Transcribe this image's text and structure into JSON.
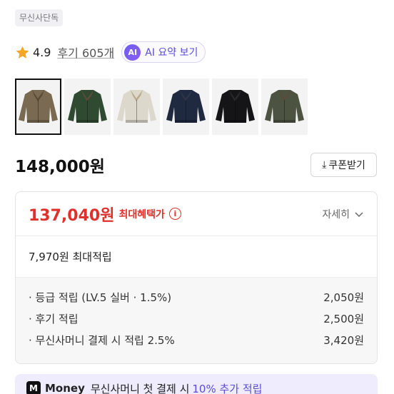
{
  "store_badge": "무신사단독",
  "rating": {
    "score": "4.9",
    "reviews_label": "후기 605개"
  },
  "ai_summary": {
    "icon_text": "AI",
    "label": "AI 요약 보기"
  },
  "thumbnails": [
    {
      "color": "#7a6a52",
      "collar": "#5a4a36"
    },
    {
      "color": "#2f4a31",
      "collar": "#5c4b39"
    },
    {
      "color": "#ddd8cc",
      "collar": "#b8a889"
    },
    {
      "color": "#1f2a40",
      "collar": "#2e3548"
    },
    {
      "color": "#151517",
      "collar": "#2a2a2a"
    },
    {
      "color": "#4c5340",
      "collar": "#5b4b3a"
    }
  ],
  "price": "148,000원",
  "coupon_button": "쿠폰받기",
  "benefit": {
    "sale_price": "137,040원",
    "max_label": "최대혜택가",
    "detail_label": "자세히",
    "points_text": "7,970원 최대적립",
    "rows": [
      {
        "label": "· 등급 적립 (LV.5 실버 · 1.5%)",
        "value": "2,050원"
      },
      {
        "label": "· 후기 적립",
        "value": "2,500원"
      },
      {
        "label": "· 무신사머니 결제 시 적립 2.5%",
        "value": "3,420원"
      }
    ]
  },
  "money_banner": {
    "logo": "M",
    "brand": "Money",
    "text": "무신사머니 첫 결제 시",
    "highlight": "10% 추가 적립"
  },
  "colors": {
    "accent_red": "#e0302c",
    "accent_purple": "#5b4bd8",
    "star": "#f5a623"
  }
}
